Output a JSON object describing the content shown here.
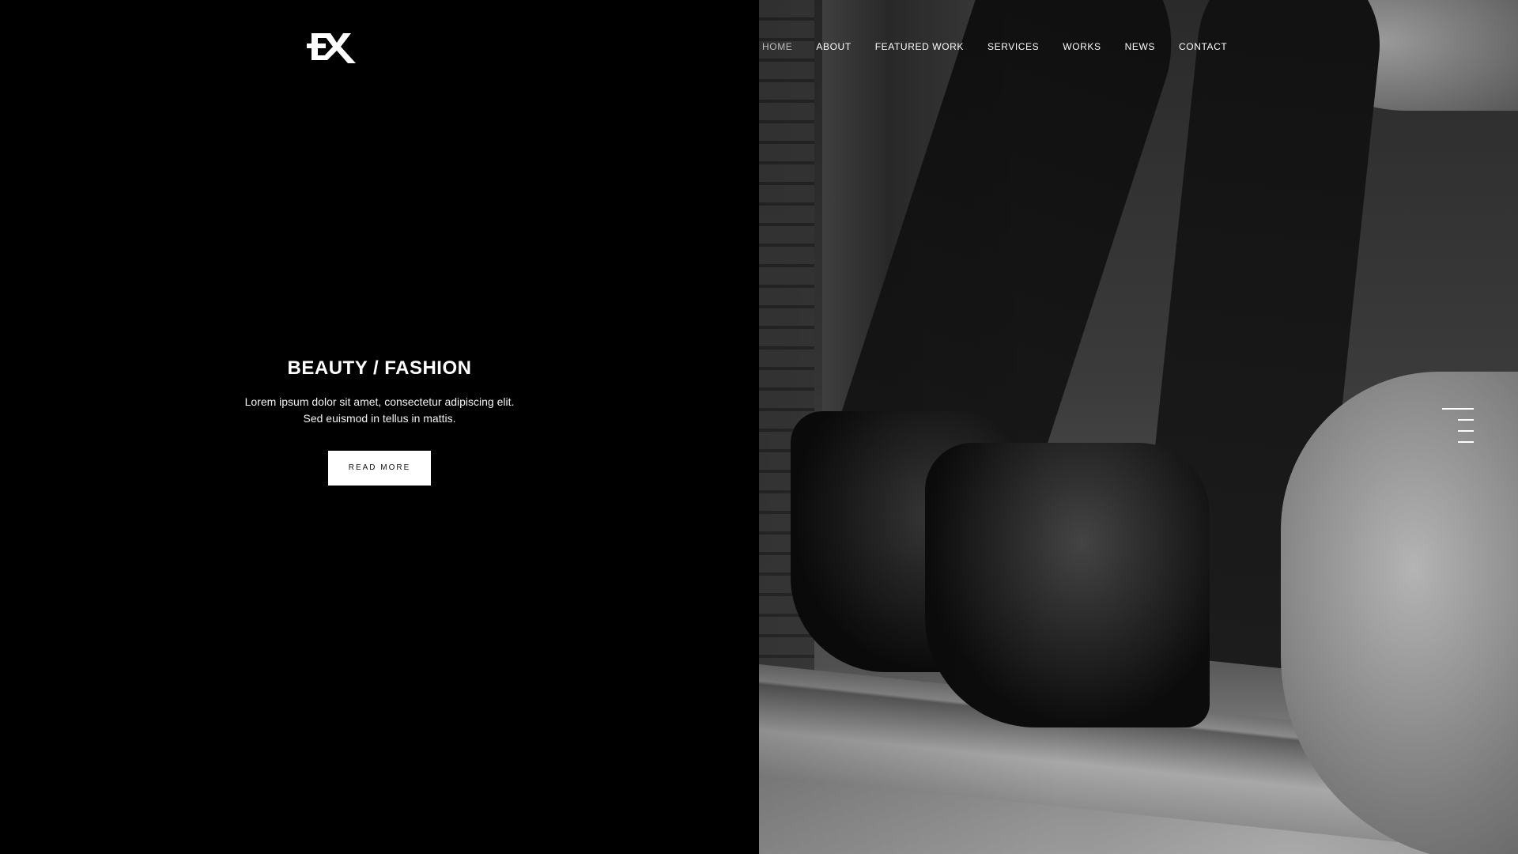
{
  "logo": {
    "text": "EX",
    "color": "#ffffff"
  },
  "nav": {
    "items": [
      {
        "label": "HOME",
        "active": true
      },
      {
        "label": "ABOUT",
        "active": false
      },
      {
        "label": "FEATURED WORK",
        "active": false
      },
      {
        "label": "SERVICES",
        "active": false
      },
      {
        "label": "WORKS",
        "active": false
      },
      {
        "label": "NEWS",
        "active": false
      },
      {
        "label": "CONTACT",
        "active": false
      }
    ]
  },
  "hero": {
    "title": "BEAUTY / FASHION",
    "description_line1": "Lorem ipsum dolor sit amet, consectetur adipiscing elit.",
    "description_line2": "Sed euismod in tellus in mattis.",
    "button_label": "READ MORE",
    "image_icon": "fashion-photo-icon"
  },
  "menu_toggle": {
    "icon": "hamburger-menu-icon"
  },
  "colors": {
    "background": "#000000",
    "text": "#ffffff",
    "nav_active": "#bdbdbd",
    "button_bg": "#ffffff",
    "button_text": "#111111"
  }
}
